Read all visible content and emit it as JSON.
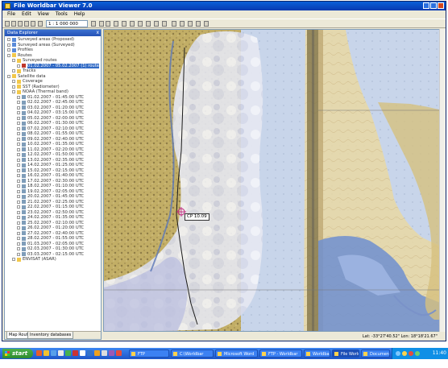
{
  "window": {
    "title": "File Worldbar Viewer 7.0"
  },
  "menu": [
    "File",
    "Edit",
    "View",
    "Tools",
    "Help"
  ],
  "toolbar": {
    "scale_value": "1 : 1 000 000"
  },
  "panel": {
    "title": "Data Explorer",
    "close": "x",
    "tabs": [
      "Map Routes",
      "Inventory databases"
    ],
    "tree": [
      {
        "label": "Surveyed areas (Proposed)",
        "indent": 0,
        "icon": "chart-icon"
      },
      {
        "label": "Surveyed areas (Surveyed)",
        "indent": 0,
        "icon": "chart-icon"
      },
      {
        "label": "Profiles",
        "indent": 0,
        "icon": "chart-icon"
      },
      {
        "label": "Routes",
        "indent": 0,
        "icon": "folder-icon"
      },
      {
        "label": "Surveyed routes",
        "indent": 1,
        "icon": "folder-icon"
      },
      {
        "label": "01.02.2007 - 05.02.2007 (1) route",
        "indent": 2,
        "icon": "route-icon",
        "selected": true
      },
      {
        "label": "Tracks",
        "indent": 1,
        "icon": "folder-icon"
      },
      {
        "label": "Satellite data",
        "indent": 0,
        "icon": "folder-icon"
      },
      {
        "label": "Coverage",
        "indent": 1,
        "icon": "folder-icon"
      },
      {
        "label": "SST (Radiometer)",
        "indent": 1,
        "icon": "folder-icon"
      },
      {
        "label": "NOAA (Thermal band)",
        "indent": 1,
        "icon": "folder-icon"
      },
      {
        "label": "01.02.2007 - 01:45:00 UTC",
        "indent": 2,
        "icon": "image-icon"
      },
      {
        "label": "02.02.2007 - 02:45:00 UTC",
        "indent": 2,
        "icon": "image-icon"
      },
      {
        "label": "03.02.2007 - 01:20:00 UTC",
        "indent": 2,
        "icon": "image-icon"
      },
      {
        "label": "04.02.2007 - 03:15:00 UTC",
        "indent": 2,
        "icon": "image-icon"
      },
      {
        "label": "05.02.2007 - 02:00:00 UTC",
        "indent": 2,
        "icon": "image-icon"
      },
      {
        "label": "06.02.2007 - 01:30:00 UTC",
        "indent": 2,
        "icon": "image-icon"
      },
      {
        "label": "07.02.2007 - 02:10:00 UTC",
        "indent": 2,
        "icon": "image-icon"
      },
      {
        "label": "08.02.2007 - 01:55:00 UTC",
        "indent": 2,
        "icon": "image-icon"
      },
      {
        "label": "09.02.2007 - 02:40:00 UTC",
        "indent": 2,
        "icon": "image-icon"
      },
      {
        "label": "10.02.2007 - 01:35:00 UTC",
        "indent": 2,
        "icon": "image-icon"
      },
      {
        "label": "11.02.2007 - 02:20:00 UTC",
        "indent": 2,
        "icon": "image-icon"
      },
      {
        "label": "12.02.2007 - 01:50:00 UTC",
        "indent": 2,
        "icon": "image-icon"
      },
      {
        "label": "13.02.2007 - 02:35:00 UTC",
        "indent": 2,
        "icon": "image-icon"
      },
      {
        "label": "14.02.2007 - 01:25:00 UTC",
        "indent": 2,
        "icon": "image-icon"
      },
      {
        "label": "15.02.2007 - 02:15:00 UTC",
        "indent": 2,
        "icon": "image-icon"
      },
      {
        "label": "16.02.2007 - 01:40:00 UTC",
        "indent": 2,
        "icon": "image-icon"
      },
      {
        "label": "17.02.2007 - 02:30:00 UTC",
        "indent": 2,
        "icon": "image-icon"
      },
      {
        "label": "18.02.2007 - 01:10:00 UTC",
        "indent": 2,
        "icon": "image-icon"
      },
      {
        "label": "19.02.2007 - 02:05:00 UTC",
        "indent": 2,
        "icon": "image-icon"
      },
      {
        "label": "20.02.2007 - 01:45:00 UTC",
        "indent": 2,
        "icon": "image-icon"
      },
      {
        "label": "21.02.2007 - 02:25:00 UTC",
        "indent": 2,
        "icon": "image-icon"
      },
      {
        "label": "22.02.2007 - 01:15:00 UTC",
        "indent": 2,
        "icon": "image-icon"
      },
      {
        "label": "23.02.2007 - 02:50:00 UTC",
        "indent": 2,
        "icon": "image-icon"
      },
      {
        "label": "24.02.2007 - 01:35:00 UTC",
        "indent": 2,
        "icon": "image-icon"
      },
      {
        "label": "25.02.2007 - 02:10:00 UTC",
        "indent": 2,
        "icon": "image-icon"
      },
      {
        "label": "26.02.2007 - 01:20:00 UTC",
        "indent": 2,
        "icon": "image-icon"
      },
      {
        "label": "27.02.2007 - 02:40:00 UTC",
        "indent": 2,
        "icon": "image-icon"
      },
      {
        "label": "28.02.2007 - 01:55:00 UTC",
        "indent": 2,
        "icon": "image-icon"
      },
      {
        "label": "01.03.2007 - 02:05:00 UTC",
        "indent": 2,
        "icon": "image-icon"
      },
      {
        "label": "02.03.2007 - 01:30:00 UTC",
        "indent": 2,
        "icon": "image-icon"
      },
      {
        "label": "03.03.2007 - 02:15:00 UTC",
        "indent": 2,
        "icon": "image-icon"
      },
      {
        "label": "ENVISAT (ASAR)",
        "indent": 1,
        "icon": "folder-icon"
      }
    ]
  },
  "map": {
    "marker_label": "CP 10.09"
  },
  "statusbar": {
    "coords": "Lat: -33°27'40.52\" Lon: 18°18'21.67\""
  },
  "taskbar": {
    "start": "start",
    "tasks": [
      "FTP",
      "C:\\Worldbar",
      "Microsoft Word",
      "FTP - Worldbar",
      "Worldbar",
      "File Worldbar Viewer",
      "Document - Paint"
    ],
    "active_task": 5,
    "clock": "11:40"
  },
  "colors": {
    "land": "#c9b56a",
    "sea": "#b9cbe6",
    "deep_sea": "#6f8fd0",
    "track": "#1a1a1a"
  }
}
